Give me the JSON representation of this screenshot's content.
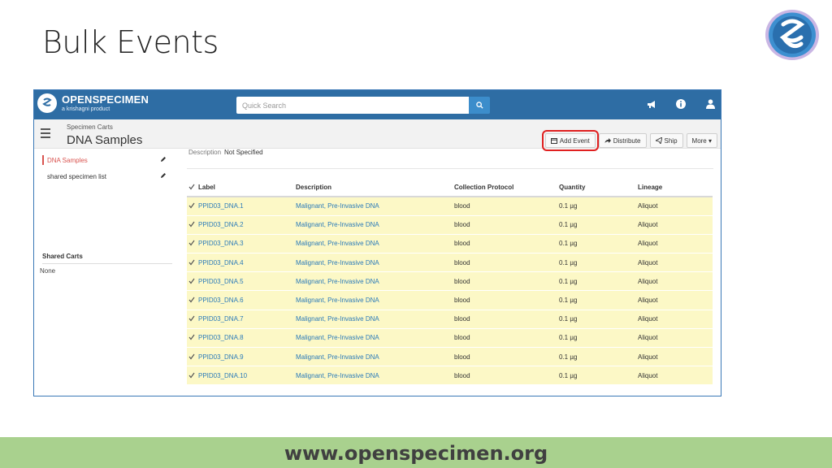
{
  "slide": {
    "title": "Bulk Events",
    "footer_url": "www.openspecimen.org"
  },
  "app": {
    "brand_name": "OPENSPECIMEN",
    "brand_sub": "a krishagni product",
    "search_placeholder": "Quick Search",
    "colors": {
      "navbar": "#2e6da4",
      "link": "#2a7ab9",
      "row_highlight": "#fcf8c6",
      "active": "#d9534f",
      "callout": "#e02020"
    }
  },
  "header": {
    "breadcrumb": "Specimen Carts",
    "title": "DNA Samples"
  },
  "toolbar": {
    "add_event": "Add Event",
    "distribute": "Distribute",
    "ship": "Ship",
    "more": "More ▾"
  },
  "sidebar": {
    "items": [
      {
        "label": "DNA Samples",
        "active": true
      },
      {
        "label": "shared specimen list",
        "active": false
      }
    ],
    "shared_title": "Shared Carts",
    "shared_none": "None"
  },
  "main": {
    "description_label": "Description",
    "description_value": "Not Specified"
  },
  "table": {
    "columns": [
      "Label",
      "Description",
      "Collection Protocol",
      "Quantity",
      "Lineage"
    ],
    "rows": [
      [
        "PPID03_DNA.1",
        "Malignant, Pre-Invasive DNA",
        "blood",
        "0.1 µg",
        "Aliquot"
      ],
      [
        "PPID03_DNA.2",
        "Malignant, Pre-Invasive DNA",
        "blood",
        "0.1 µg",
        "Aliquot"
      ],
      [
        "PPID03_DNA.3",
        "Malignant, Pre-Invasive DNA",
        "blood",
        "0.1 µg",
        "Aliquot"
      ],
      [
        "PPID03_DNA.4",
        "Malignant, Pre-Invasive DNA",
        "blood",
        "0.1 µg",
        "Aliquot"
      ],
      [
        "PPID03_DNA.5",
        "Malignant, Pre-Invasive DNA",
        "blood",
        "0.1 µg",
        "Aliquot"
      ],
      [
        "PPID03_DNA.6",
        "Malignant, Pre-Invasive DNA",
        "blood",
        "0.1 µg",
        "Aliquot"
      ],
      [
        "PPID03_DNA.7",
        "Malignant, Pre-Invasive DNA",
        "blood",
        "0.1 µg",
        "Aliquot"
      ],
      [
        "PPID03_DNA.8",
        "Malignant, Pre-Invasive DNA",
        "blood",
        "0.1 µg",
        "Aliquot"
      ],
      [
        "PPID03_DNA.9",
        "Malignant, Pre-Invasive DNA",
        "blood",
        "0.1 µg",
        "Aliquot"
      ],
      [
        "PPID03_DNA.10",
        "Malignant, Pre-Invasive DNA",
        "blood",
        "0.1 µg",
        "Aliquot"
      ]
    ]
  }
}
